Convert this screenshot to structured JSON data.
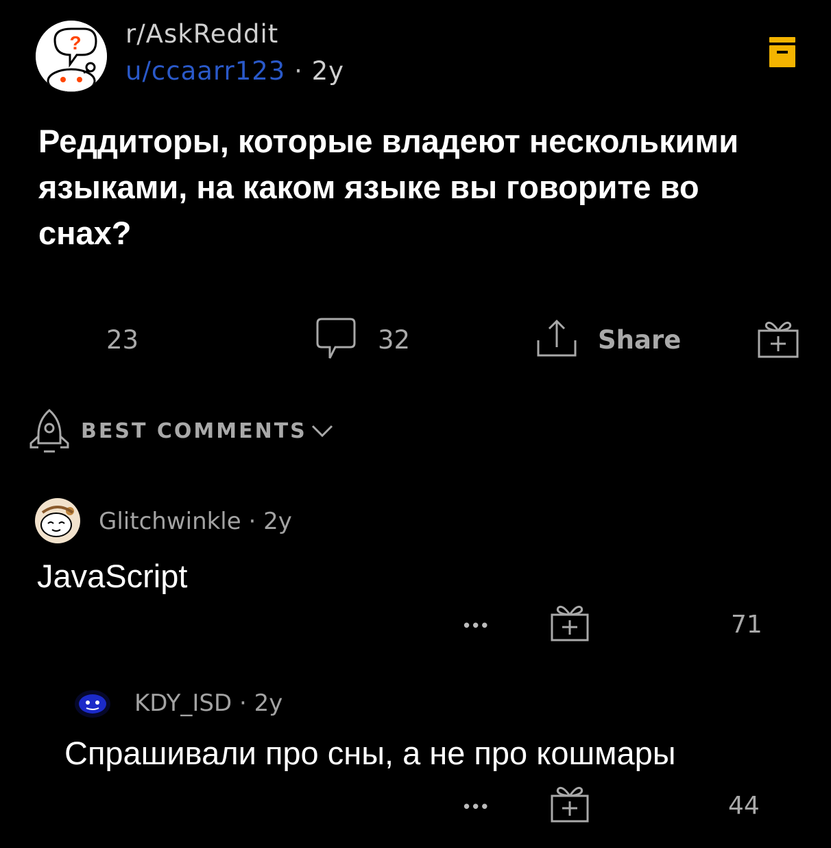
{
  "post": {
    "subreddit": "r/AskReddit",
    "author": "u/ccaarr123",
    "separator": "·",
    "age": "2y",
    "title": "Реддиторы, которые владеют несколькими языками, на каком языке вы говорите во снах?"
  },
  "actions": {
    "votes": "23",
    "comments": "32",
    "share_label": "Share"
  },
  "sort": {
    "label": "BEST COMMENTS"
  },
  "comments": [
    {
      "author": "Glitchwinkle",
      "separator": "·",
      "age": "2y",
      "body": "JavaScript",
      "more": "•••",
      "votes": "71"
    },
    {
      "author": "KDY_ISD",
      "separator": "·",
      "age": "2y",
      "body": "Спрашивали про сны, а не про кошмары",
      "more": "•••",
      "votes": "44"
    }
  ],
  "colors": {
    "background": "#000000",
    "author_link": "#2a59c9",
    "save_icon": "#f4b400",
    "muted_text": "#a9a9a9"
  },
  "icons": [
    "askreddit-logo",
    "save-icon",
    "comment-icon",
    "share-icon",
    "award-icon",
    "rocket-icon",
    "chevron-down-icon",
    "avatar"
  ]
}
